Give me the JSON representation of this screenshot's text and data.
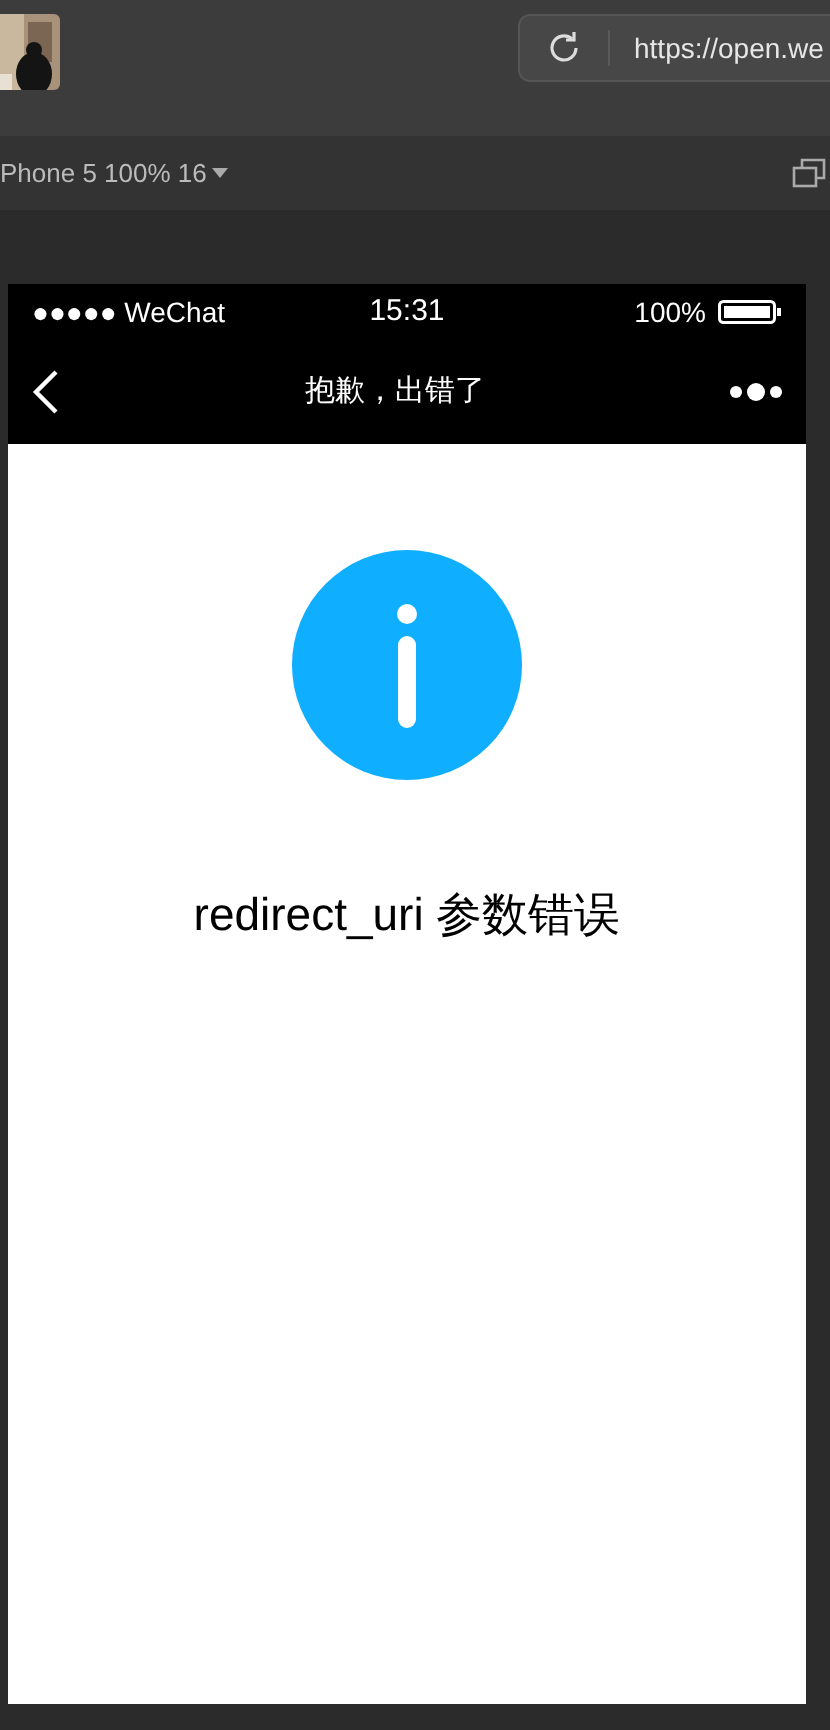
{
  "browser": {
    "url": "https://open.we",
    "device": "Phone 5 100% 16"
  },
  "status_bar": {
    "signal": "●●●●● WeChat",
    "time": "15:31",
    "battery": "100%"
  },
  "nav": {
    "title": "抱歉，出错了"
  },
  "message": "redirect_uri 参数错误"
}
